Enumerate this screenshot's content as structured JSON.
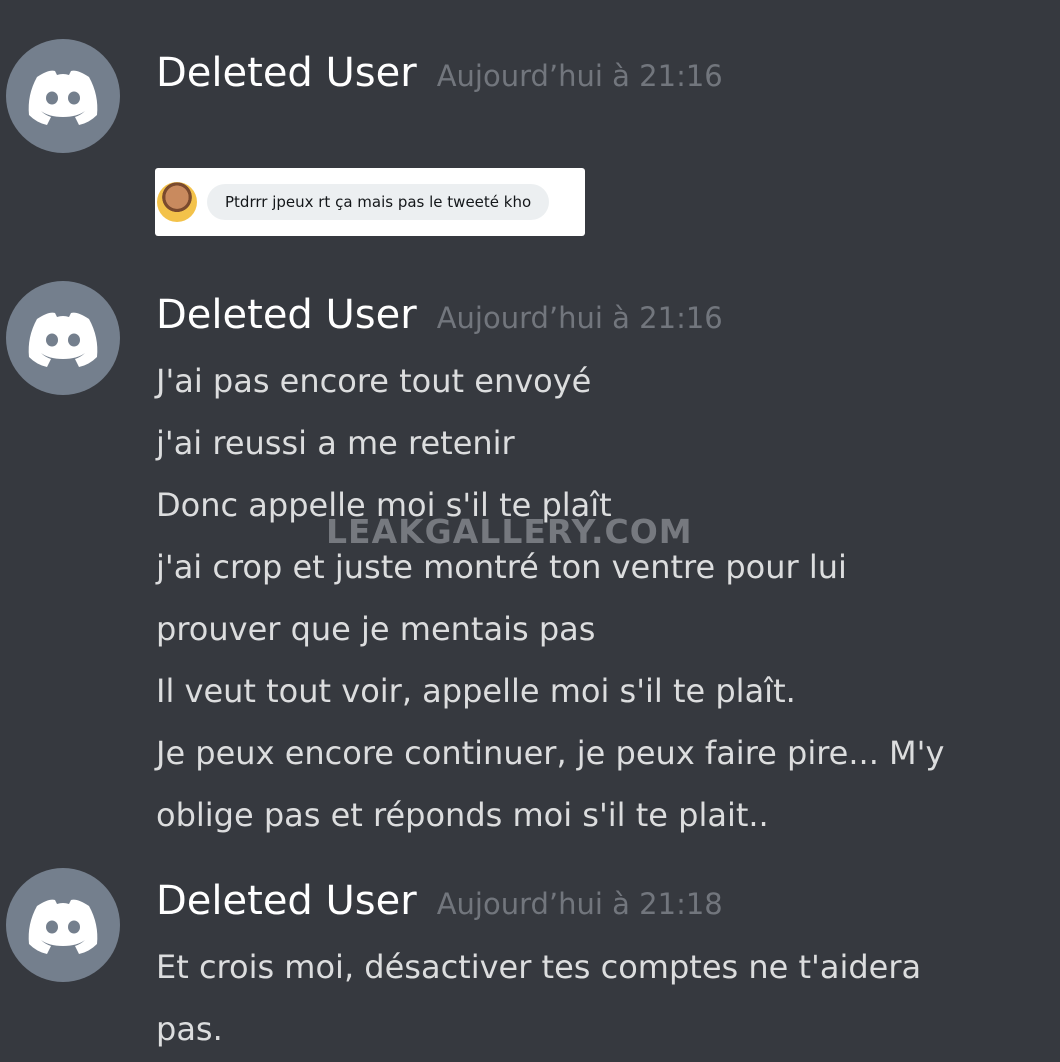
{
  "messages": [
    {
      "username": "Deleted User",
      "timestamp": "Aujourd’hui à 21:16",
      "embed": {
        "text": "Ptdrrr jpeux rt ça mais pas le tweeté kho"
      }
    },
    {
      "username": "Deleted User",
      "timestamp": "Aujourd’hui à 21:16",
      "lines": [
        "J'ai pas encore tout envoyé",
        "j'ai reussi a me retenir",
        "Donc appelle moi s'il te plaît",
        "j'ai crop et juste montré ton ventre pour lui",
        "prouver que je mentais pas",
        "Il veut tout voir, appelle moi s'il te plaît.",
        "Je peux encore continuer, je peux faire pire... M'y",
        "oblige pas et réponds moi s'il te plait.."
      ]
    },
    {
      "username": "Deleted User",
      "timestamp": "Aujourd’hui à 21:18",
      "lines": [
        "Et crois moi, désactiver tes comptes ne t'aidera",
        "pas."
      ]
    }
  ],
  "watermark": "LEAKGALLERY.COM",
  "colors": {
    "background": "#36393f",
    "username": "#ffffff",
    "timestamp": "#72767d",
    "text": "#dcddde",
    "avatar": "#747f8d"
  },
  "icons": {
    "avatar": "discord-logo-icon"
  }
}
